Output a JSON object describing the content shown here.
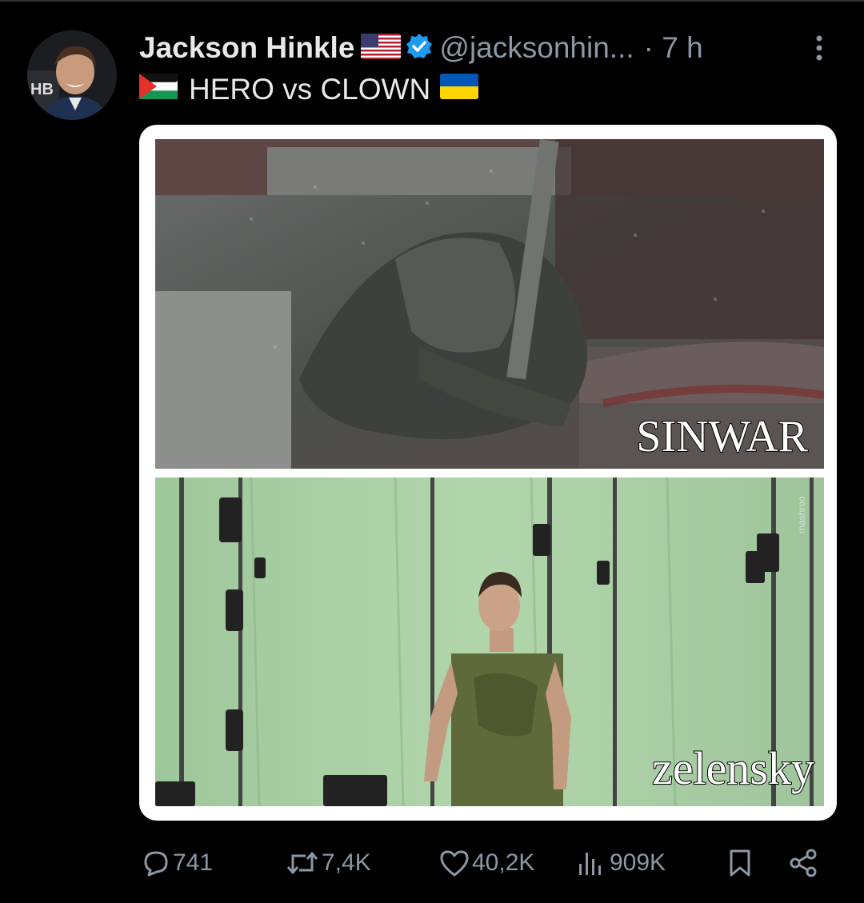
{
  "post": {
    "author_name": "Jackson Hinkle",
    "handle": "@jacksonhin...",
    "time": "· 7 h",
    "avatar_badge": "HB",
    "text": "HERO vs CLOWN"
  },
  "media": {
    "top_caption": "SINWAR",
    "bottom_caption": "zelensky",
    "watermark": "mashroo"
  },
  "actions": {
    "replies": "741",
    "reposts": "7,4K",
    "likes": "40,2K",
    "views": "909K"
  },
  "colors": {
    "background": "#000000",
    "text_primary": "#e7e9ea",
    "text_secondary": "#8b98a5",
    "verified": "#1d9bf0",
    "green_screen": "#a7cba0"
  },
  "icons": [
    "verified-badge-icon",
    "us-flag-icon",
    "palestine-flag-icon",
    "ukraine-flag-icon",
    "more-icon",
    "reply-icon",
    "repost-icon",
    "like-icon",
    "views-icon",
    "bookmark-icon",
    "share-icon"
  ]
}
